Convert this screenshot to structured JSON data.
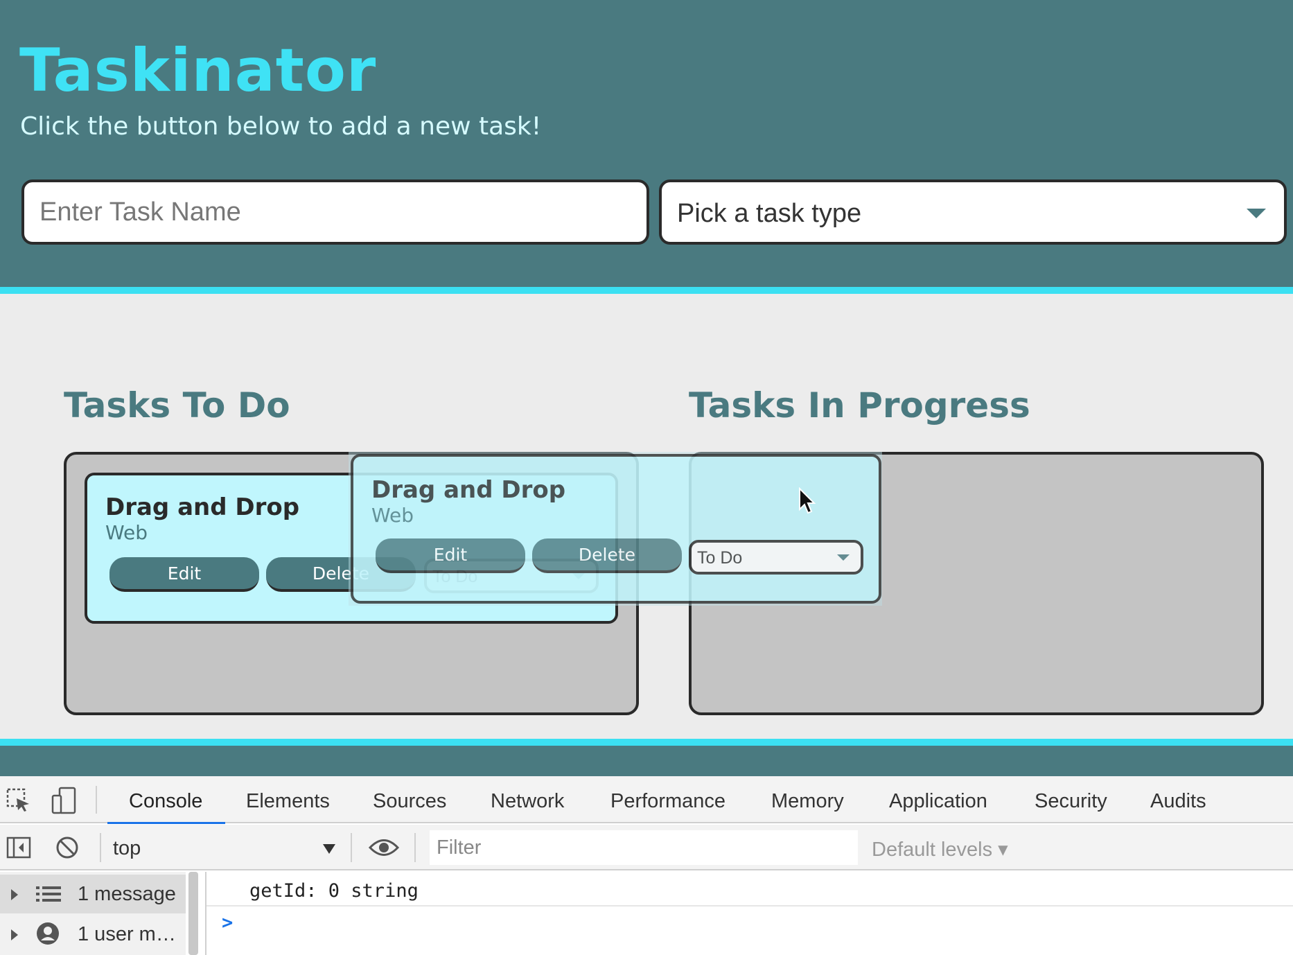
{
  "header": {
    "title": "Taskinator",
    "subtitle": "Click the button below to add a new task!",
    "task_name_placeholder": "Enter Task Name",
    "task_type_selected": "Pick a task type"
  },
  "columns": [
    {
      "heading": "Tasks To Do"
    },
    {
      "heading": "Tasks In Progress"
    }
  ],
  "task": {
    "name": "Drag and Drop",
    "type": "Web",
    "edit_label": "Edit",
    "delete_label": "Delete",
    "status": "To Do"
  },
  "devtools": {
    "tabs": [
      "Console",
      "Elements",
      "Sources",
      "Network",
      "Performance",
      "Memory",
      "Application",
      "Security",
      "Audits"
    ],
    "active_tab": "Console",
    "context": "top",
    "filter_placeholder": "Filter",
    "levels": "Default levels ▾",
    "sidebar": [
      "1 message",
      "1 user m…"
    ],
    "log_line": "getId: 0 string",
    "prompt": ">"
  },
  "colors": {
    "header_bg": "#4a7a80",
    "accent": "#3be0f2",
    "card_bg": "#c0f6fd",
    "column_bg": "#c4c4c4"
  }
}
